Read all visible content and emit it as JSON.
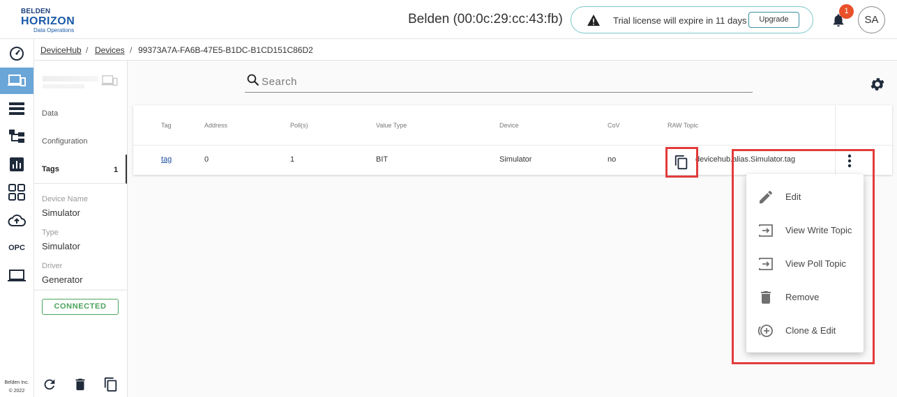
{
  "header": {
    "logo_line1": "BELDEN",
    "logo_line2": "HORIZON",
    "logo_line3": "Data Operations",
    "device_title": "Belden (00:0c:29:cc:43:fb)",
    "license_message": "Trial license will expire in 11 days",
    "upgrade_label": "Upgrade",
    "notification_count": "1",
    "avatar_initials": "SA"
  },
  "rail": {
    "items": [
      "dashboard-icon",
      "devices-icon",
      "list-icon",
      "topology-icon",
      "chart-icon",
      "apps-icon",
      "cloud-upload-icon",
      "OPC",
      "laptop-icon"
    ],
    "active_index": 1,
    "active_color": "#6aa6d8",
    "copyright_line1": "Belden Inc.",
    "copyright_line2": "© 2022"
  },
  "breadcrumb": {
    "root": "DeviceHub",
    "section": "Devices",
    "current": "99373A7A-FA6B-47E5-B1DC-B1CD151C86D2"
  },
  "side": {
    "nav": [
      "Data",
      "Configuration",
      "Tags"
    ],
    "tags_count": "1",
    "device_name_label": "Device Name",
    "device_name_value": "Simulator",
    "type_label": "Type",
    "type_value": "Simulator",
    "driver_label": "Driver",
    "driver_value": "Generator",
    "status": "CONNECTED",
    "status_color": "#4aa35a"
  },
  "search": {
    "placeholder": "Search"
  },
  "table": {
    "headers": [
      "Tag",
      "Address",
      "Poll(s)",
      "Value Type",
      "Device",
      "CoV",
      "RAW Topic"
    ],
    "rows": [
      {
        "tag": "tag",
        "address": "0",
        "poll": "1",
        "value_type": "BIT",
        "device": "Simulator",
        "cov": "no",
        "raw_topic": "devicehub.alias.Simulator.tag"
      }
    ]
  },
  "context_menu": {
    "items": [
      {
        "label": "Edit",
        "icon": "pencil-icon"
      },
      {
        "label": "View Write Topic",
        "icon": "topic-arrow-icon"
      },
      {
        "label": "View Poll Topic",
        "icon": "topic-arrow-icon"
      },
      {
        "label": "Remove",
        "icon": "trash-icon"
      },
      {
        "label": "Clone & Edit",
        "icon": "clone-icon"
      }
    ]
  },
  "highlight_color": "#e33b3b"
}
